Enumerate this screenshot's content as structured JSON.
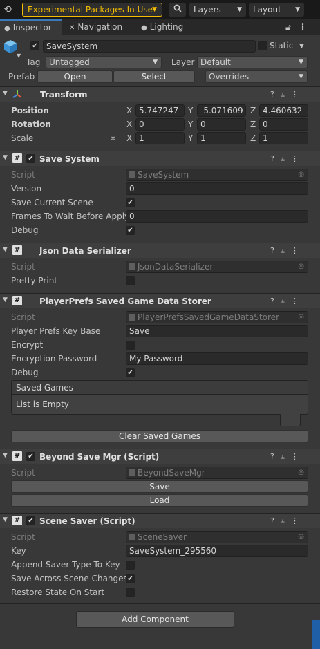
{
  "toolbar": {
    "history_icon": "history-icon",
    "experimental_label": "Experimental Packages In Use",
    "layers_label": "Layers",
    "layout_label": "Layout"
  },
  "tabs": [
    {
      "label": "Inspector",
      "icon": "info-icon"
    },
    {
      "label": "Navigation",
      "icon": "navigation-icon"
    },
    {
      "label": "Lighting",
      "icon": "bulb-icon"
    }
  ],
  "object": {
    "name": "SaveSystem",
    "static_label": "Static",
    "tag_label": "Tag",
    "tag_value": "Untagged",
    "layer_label": "Layer",
    "layer_value": "Default",
    "prefab_label": "Prefab",
    "open_label": "Open",
    "select_label": "Select",
    "overrides_label": "Overrides"
  },
  "transform": {
    "title": "Transform",
    "position_label": "Position",
    "rotation_label": "Rotation",
    "scale_label": "Scale",
    "position": {
      "x": "5.747247",
      "y": "-5.071609",
      "z": "4.460632"
    },
    "rotation": {
      "x": "0",
      "y": "0",
      "z": "0"
    },
    "scale": {
      "x": "1",
      "y": "1",
      "z": "1"
    },
    "axis_x": "X",
    "axis_y": "Y",
    "axis_z": "Z"
  },
  "save_system": {
    "title": "Save System",
    "script_label": "Script",
    "script_value": "SaveSystem",
    "version_label": "Version",
    "version_value": "0",
    "save_scene_label": "Save Current Scene",
    "save_scene_checked": "✔",
    "frames_label": "Frames To Wait Before Apply",
    "frames_value": "0",
    "debug_label": "Debug",
    "debug_checked": "✔"
  },
  "json_serializer": {
    "title": "Json Data Serializer",
    "script_label": "Script",
    "script_value": "JsonDataSerializer",
    "pretty_label": "Pretty Print"
  },
  "playerprefs": {
    "title": "PlayerPrefs Saved Game Data Storer",
    "script_label": "Script",
    "script_value": "PlayerPrefsSavedGameDataStorer",
    "key_base_label": "Player Prefs Key Base",
    "key_base_value": "Save",
    "encrypt_label": "Encrypt",
    "enc_pass_label": "Encryption Password",
    "enc_pass_value": "My Password",
    "debug_label": "Debug",
    "debug_checked": "✔",
    "saved_games_label": "Saved Games",
    "list_empty_label": "List is Empty",
    "minus_label": "—",
    "clear_label": "Clear Saved Games"
  },
  "beyond_save": {
    "title": "Beyond Save Mgr (Script)",
    "script_label": "Script",
    "script_value": "BeyondSaveMgr",
    "save_label": "Save",
    "load_label": "Load"
  },
  "scene_saver": {
    "title": "Scene Saver (Script)",
    "script_label": "Script",
    "script_value": "SceneSaver",
    "key_label": "Key",
    "key_value": "SaveSystem_295560",
    "append_label": "Append Saver Type To Key",
    "across_label": "Save Across Scene Changes",
    "across_checked": "✔",
    "restore_label": "Restore State On Start"
  },
  "add_component_label": "Add Component",
  "colors": {
    "accent_yellow": "#f4bc02",
    "tab_highlight": "#3a79bb",
    "background": "#383838"
  }
}
